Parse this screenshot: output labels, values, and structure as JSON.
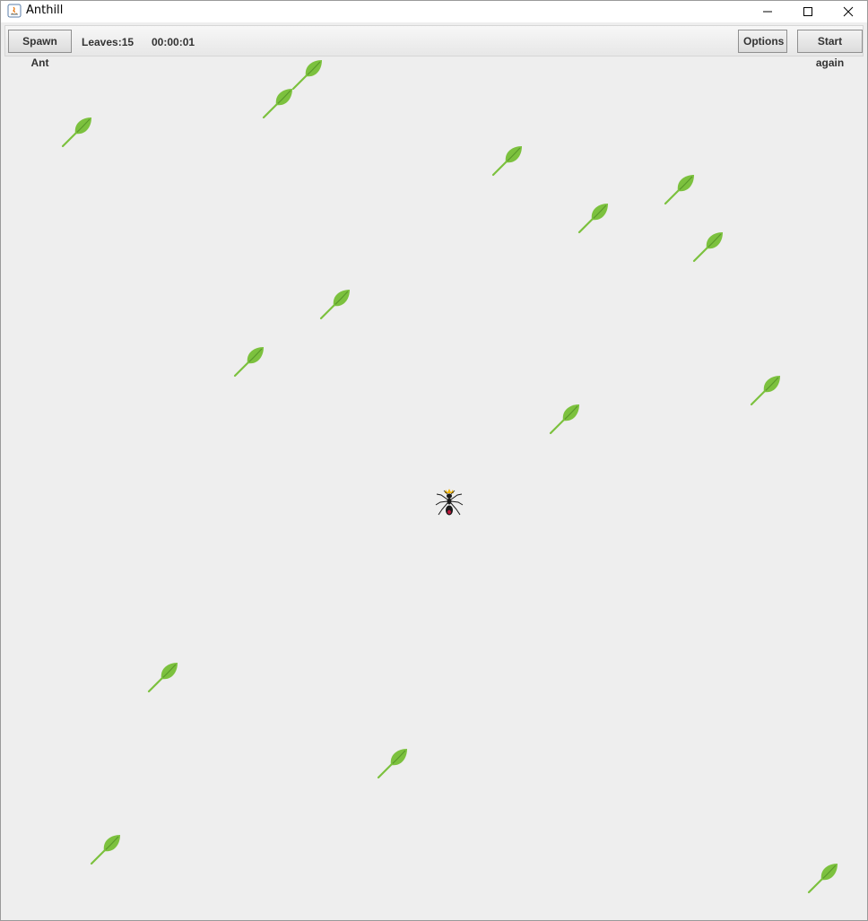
{
  "window": {
    "title": "Anthill"
  },
  "toolbar": {
    "spawn_label": "Spawn Ant",
    "leaves_label": "Leaves:15",
    "timer": "00:00:01",
    "options_label": "Options",
    "restart_label": "Start again"
  },
  "colors": {
    "leaf_fill": "#7cc13e",
    "leaf_vein": "#5a9a2a",
    "ant_body": "#1a1a1a",
    "queen_crown": "#f2b400",
    "ant_abdomen_mark": "#c0183c"
  },
  "field": {
    "leaf_count": 15,
    "queen_ant": "ant-queen-icon"
  }
}
